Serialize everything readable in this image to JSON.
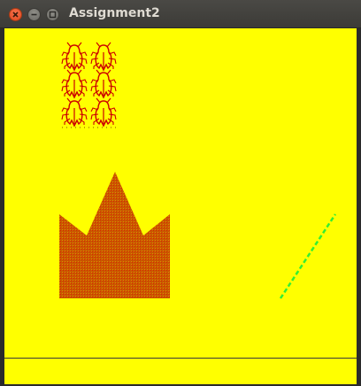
{
  "window": {
    "title": "Assignment2"
  },
  "colors": {
    "canvas_background": "#ffff00",
    "bug_color": "#cc0000",
    "crown_fill": "#cc4400",
    "line_color": "#33ee33"
  },
  "icons": {
    "close": "close-icon",
    "minimize": "minimize-icon",
    "maximize": "maximize-icon"
  },
  "canvas": {
    "bug_grid": {
      "rows": 3,
      "cols": 2
    },
    "shapes": [
      "bug-grid",
      "crown-shape",
      "dashed-line"
    ]
  }
}
